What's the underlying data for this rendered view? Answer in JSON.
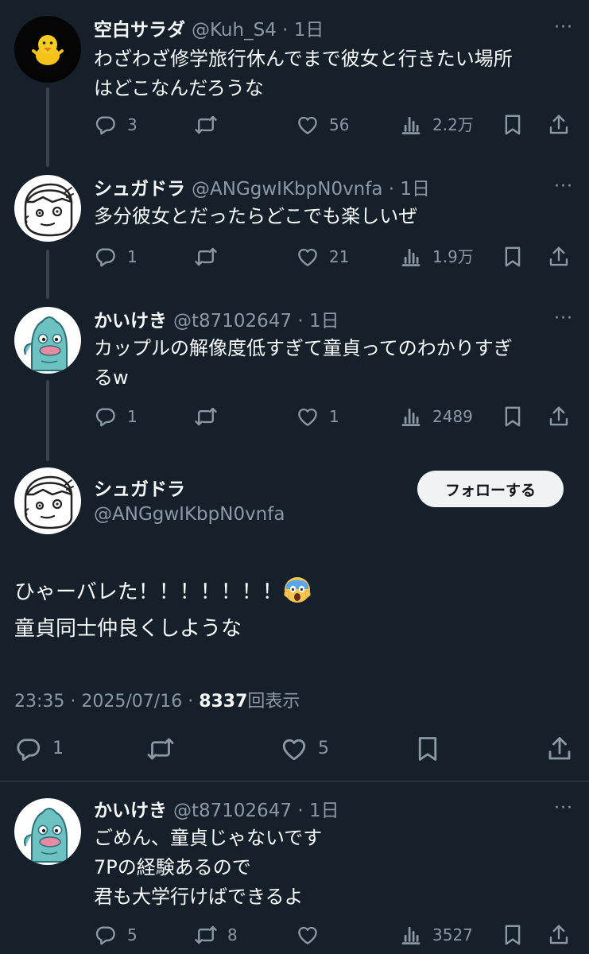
{
  "more_label": "···",
  "tweets": [
    {
      "name": "空白サラダ",
      "handle": "@Kuh_S4",
      "time": "1日",
      "text": "わざわざ修学旅行休んでまで彼女と行きたい場所\nはどこなんだろうな",
      "replies": "3",
      "retweets": "",
      "likes": "56",
      "views": "2.2万"
    },
    {
      "name": "シュガドラ",
      "handle": "@ANGgwIKbpN0vnfa",
      "time": "1日",
      "text": "多分彼女とだったらどこでも楽しいぜ",
      "replies": "1",
      "retweets": "",
      "likes": "21",
      "views": "1.9万"
    },
    {
      "name": "かいけき",
      "handle": "@t87102647",
      "time": "1日",
      "text": "カップルの解像度低すぎて童貞ってのわかりすぎ\nるw",
      "replies": "1",
      "retweets": "",
      "likes": "1",
      "views": "2489"
    }
  ],
  "main": {
    "name": "シュガドラ",
    "handle": "@ANGgwIKbpN0vnfa",
    "follow_label": "フォローする",
    "line1": "ひゃーバレた！！！！！！！",
    "line2": "童貞同士仲良くしような",
    "time": "23:35",
    "date": "2025/07/16",
    "views_count": "8337",
    "views_label": "回表示",
    "replies": "1",
    "likes": "5"
  },
  "reply": {
    "name": "かいけき",
    "handle": "@t87102647",
    "time": "1日",
    "text": "ごめん、童貞じゃないです\n7Pの経験あるので\n君も大学行けばできるよ",
    "replies": "5",
    "retweets": "8",
    "likes": "",
    "views": "3527"
  },
  "colors": {
    "background": "#15202b",
    "text": "#f7f9f9",
    "muted": "#8b98a5",
    "divider": "#38444d",
    "follow_button_bg": "#eff3f4"
  }
}
